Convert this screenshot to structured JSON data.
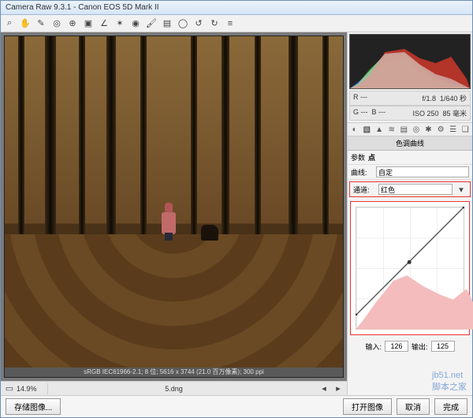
{
  "window": {
    "title": "Camera Raw 9.3.1  -  Canon EOS 5D Mark II"
  },
  "toolbar": {
    "tools": [
      "zoom",
      "hand",
      "eyedropper",
      "color-sampler",
      "target-adjust",
      "crop",
      "straighten",
      "spot",
      "redeye",
      "adjust-brush",
      "grad-filter",
      "radial-filter",
      "rotate-ccw",
      "rotate-cw",
      "prefs"
    ]
  },
  "preview": {
    "zoom": "14.9%",
    "filename": "5.dng",
    "info_line": "sRGB IEC61966-2.1; 8 位; 5616 x 3744 (21.0 百万像素); 300 ppi"
  },
  "meta": {
    "r": "---",
    "g": "---",
    "b": "---",
    "aperture": "f/1.8",
    "shutter": "1/640 秒",
    "iso_label": "ISO 250",
    "lens": "85 毫米"
  },
  "panel": {
    "title": "色调曲线",
    "tabs": [
      "basic",
      "curve",
      "detail",
      "hsl",
      "split",
      "lens",
      "fx",
      "calib",
      "preset",
      "snap"
    ],
    "subtabs_label": "参数",
    "subtabs_value": "点",
    "curve_row_label": "曲线:",
    "curve_preset": "自定",
    "channel_label": "通道:",
    "channel_value": "红色",
    "input_label": "输入:",
    "input_value": "126",
    "output_label": "输出:",
    "output_value": "125"
  },
  "footer": {
    "save_label": "存储图像...",
    "open_label": "打开图像",
    "cancel_label": "取消",
    "done_label": "完成"
  },
  "watermark": {
    "line1": "jb51.net",
    "line2": "脚本之家"
  },
  "chart_data": [
    {
      "type": "area",
      "title": "RGB Histogram",
      "x": [
        0,
        32,
        64,
        96,
        128,
        160,
        192,
        224,
        255
      ],
      "series": [
        {
          "name": "blue",
          "values": [
            5,
            12,
            28,
            35,
            20,
            10,
            5,
            2,
            0
          ]
        },
        {
          "name": "green",
          "values": [
            3,
            10,
            30,
            42,
            26,
            14,
            6,
            2,
            0
          ]
        },
        {
          "name": "red",
          "values": [
            2,
            6,
            22,
            48,
            40,
            28,
            24,
            30,
            8
          ]
        },
        {
          "name": "luma",
          "values": [
            4,
            10,
            30,
            45,
            30,
            18,
            12,
            10,
            2
          ]
        }
      ],
      "xlim": [
        0,
        255
      ],
      "ylim": [
        0,
        50
      ]
    },
    {
      "type": "line",
      "title": "Tone Curve — Red",
      "x": [
        0,
        64,
        126,
        192,
        255
      ],
      "series": [
        {
          "name": "curve",
          "values": [
            0,
            64,
            125,
            192,
            255
          ]
        },
        {
          "name": "red-hist",
          "values": [
            10,
            28,
            52,
            60,
            48,
            40,
            34,
            44,
            8
          ]
        }
      ],
      "xlabel": "输入",
      "ylabel": "输出",
      "xlim": [
        0,
        255
      ],
      "ylim": [
        0,
        255
      ]
    }
  ]
}
